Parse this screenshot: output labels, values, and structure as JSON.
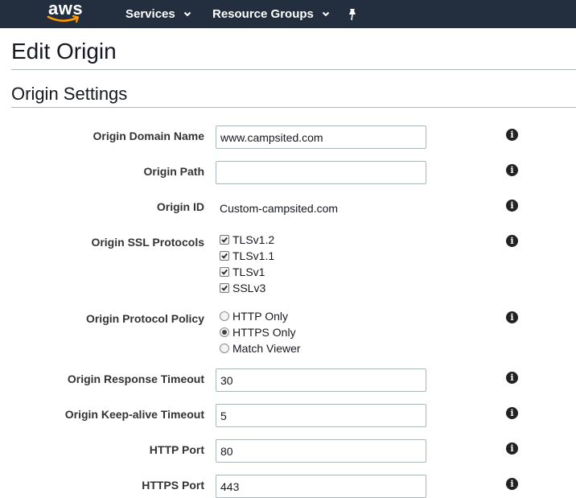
{
  "nav": {
    "logo_text": "aws",
    "services_label": "Services",
    "resource_groups_label": "Resource Groups"
  },
  "page": {
    "title": "Edit Origin",
    "section_title": "Origin Settings"
  },
  "form": {
    "origin_domain_name": {
      "label": "Origin Domain Name",
      "value": "www.campsited.com"
    },
    "origin_path": {
      "label": "Origin Path",
      "value": ""
    },
    "origin_id": {
      "label": "Origin ID",
      "value": "Custom-campsited.com"
    },
    "ssl_protocols": {
      "label": "Origin SSL Protocols",
      "options": [
        {
          "label": "TLSv1.2",
          "checked": true
        },
        {
          "label": "TLSv1.1",
          "checked": true
        },
        {
          "label": "TLSv1",
          "checked": true
        },
        {
          "label": "SSLv3",
          "checked": true
        }
      ]
    },
    "protocol_policy": {
      "label": "Origin Protocol Policy",
      "options": [
        {
          "label": "HTTP Only",
          "selected": false
        },
        {
          "label": "HTTPS Only",
          "selected": true
        },
        {
          "label": "Match Viewer",
          "selected": false
        }
      ]
    },
    "response_timeout": {
      "label": "Origin Response Timeout",
      "value": "30"
    },
    "keepalive_timeout": {
      "label": "Origin Keep-alive Timeout",
      "value": "5"
    },
    "http_port": {
      "label": "HTTP Port",
      "value": "80"
    },
    "https_port": {
      "label": "HTTPS Port",
      "value": "443"
    }
  },
  "icons": {
    "info": "info-icon",
    "pin": "pin-icon",
    "chevron": "chevron-down-icon"
  },
  "colors": {
    "nav_bg": "#232f3e",
    "aws_smile": "#ff9900"
  }
}
